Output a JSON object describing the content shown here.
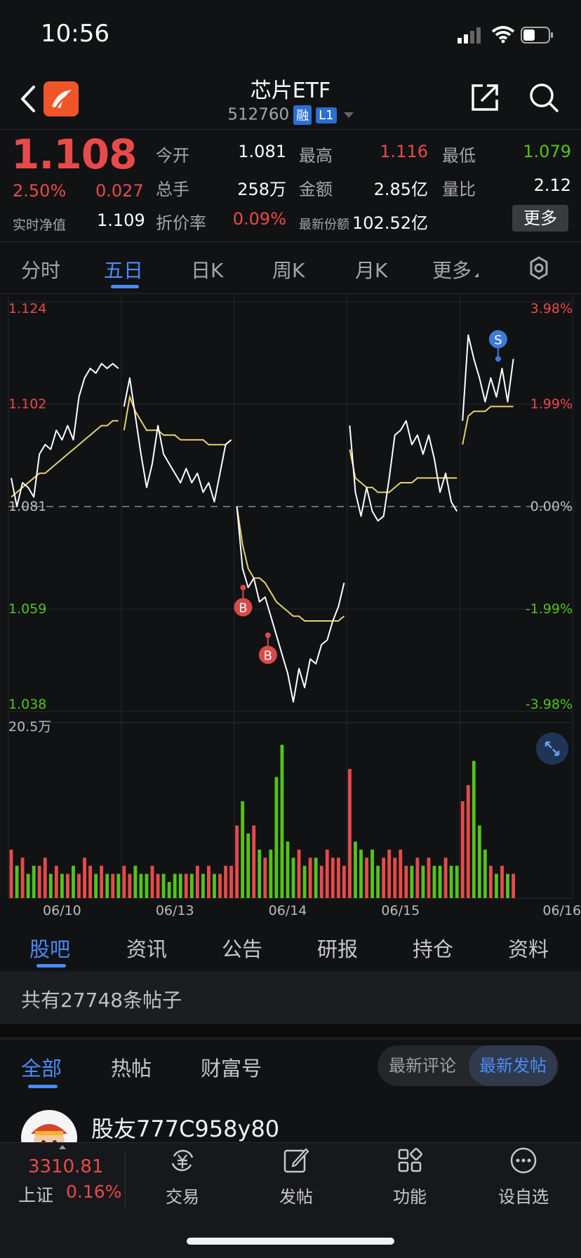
{
  "status": {
    "time": "10:56"
  },
  "header": {
    "title": "芯片ETF",
    "code": "512760",
    "tag_rong": "融",
    "tag_level": "L1"
  },
  "quote": {
    "price": "1.108",
    "pct": "2.50%",
    "change": "0.027",
    "nav_label": "实时净值",
    "nav_value": "1.109",
    "open_label": "今开",
    "open_value": "1.081",
    "high_label": "最高",
    "high_value": "1.116",
    "low_label": "最低",
    "low_value": "1.079",
    "vol_label": "总手",
    "vol_value": "258万",
    "amount_label": "金额",
    "amount_value": "2.85亿",
    "ratio_label": "量比",
    "ratio_value": "2.12",
    "discount_label": "折价率",
    "discount_value": "0.09%",
    "shares_label": "最新份额",
    "shares_value": "102.52亿",
    "more": "更多"
  },
  "chart_tabs": [
    "分时",
    "五日",
    "日K",
    "周K",
    "月K",
    "更多"
  ],
  "colors": {
    "up": "#e84a4a",
    "down": "#52c41a",
    "accent": "#4a8cf7",
    "avg_line": "#e5d36a",
    "price_line": "#ffffff"
  },
  "chart_data": {
    "type": "line",
    "title": "",
    "y_axis_left": [
      "1.124",
      "1.102",
      "1.081",
      "1.059",
      "1.038"
    ],
    "y_axis_right": [
      "3.98%",
      "1.99%",
      "0.00%",
      "-1.99%",
      "-3.98%"
    ],
    "ylim": [
      1.038,
      1.124
    ],
    "prev_close": 1.081,
    "x_labels": [
      "06/10",
      "06/13",
      "06/14",
      "06/15",
      "06/16"
    ],
    "volume_max_label": "20.5万",
    "markers": [
      {
        "label": "B",
        "day": 2,
        "pos": 0.08,
        "price": 1.064
      },
      {
        "label": "B",
        "day": 2,
        "pos": 0.3,
        "price": 1.054
      },
      {
        "label": "S",
        "day": 4,
        "pos": 0.34,
        "price": 1.112
      }
    ],
    "days": [
      {
        "date": "06/10",
        "price": [
          1.087,
          1.081,
          1.086,
          1.085,
          1.083,
          1.092,
          1.094,
          1.093,
          1.097,
          1.095,
          1.098,
          1.095,
          1.104,
          1.108,
          1.11,
          1.109,
          1.111,
          1.11,
          1.111,
          1.11
        ],
        "avg": [
          1.083,
          1.084,
          1.085,
          1.086,
          1.087,
          1.088,
          1.088,
          1.089,
          1.09,
          1.091,
          1.092,
          1.093,
          1.094,
          1.095,
          1.096,
          1.097,
          1.098,
          1.098,
          1.099,
          1.099
        ]
      },
      {
        "date": "06/13",
        "price": [
          1.102,
          1.108,
          1.1,
          1.092,
          1.085,
          1.09,
          1.098,
          1.092,
          1.09,
          1.088,
          1.086,
          1.089,
          1.086,
          1.088,
          1.084,
          1.086,
          1.082,
          1.088,
          1.094,
          1.095
        ],
        "avg": [
          1.097,
          1.104,
          1.101,
          1.099,
          1.097,
          1.097,
          1.097,
          1.096,
          1.096,
          1.096,
          1.095,
          1.095,
          1.095,
          1.095,
          1.095,
          1.094,
          1.094,
          1.094,
          1.094,
          1.095
        ]
      },
      {
        "date": "06/14",
        "price": [
          1.081,
          1.068,
          1.064,
          1.066,
          1.061,
          1.062,
          1.058,
          1.054,
          1.05,
          1.046,
          1.04,
          1.047,
          1.043,
          1.049,
          1.048,
          1.052,
          1.053,
          1.057,
          1.06,
          1.065
        ],
        "avg": [
          1.081,
          1.073,
          1.068,
          1.066,
          1.066,
          1.065,
          1.063,
          1.061,
          1.06,
          1.059,
          1.058,
          1.058,
          1.057,
          1.057,
          1.057,
          1.057,
          1.057,
          1.057,
          1.057,
          1.058
        ]
      },
      {
        "date": "06/15",
        "price": [
          1.098,
          1.084,
          1.079,
          1.085,
          1.08,
          1.078,
          1.079,
          1.087,
          1.096,
          1.097,
          1.099,
          1.094,
          1.096,
          1.092,
          1.096,
          1.091,
          1.084,
          1.088,
          1.082,
          1.08
        ],
        "avg": [
          1.093,
          1.087,
          1.086,
          1.085,
          1.085,
          1.084,
          1.084,
          1.084,
          1.085,
          1.086,
          1.086,
          1.086,
          1.087,
          1.087,
          1.087,
          1.087,
          1.087,
          1.087,
          1.087,
          1.087
        ]
      },
      {
        "date": "06/16",
        "price": [
          1.099,
          1.117,
          1.112,
          1.108,
          1.103,
          1.108,
          1.104,
          1.11,
          1.103,
          1.112
        ],
        "avg": [
          1.094,
          1.1,
          1.101,
          1.101,
          1.101,
          1.102,
          1.102,
          1.102,
          1.102,
          1.102
        ]
      }
    ],
    "volumes": [
      [
        6,
        4,
        5,
        3,
        4,
        4,
        5,
        3,
        4,
        3,
        3,
        4,
        3,
        5,
        4,
        3,
        4,
        3,
        3,
        3
      ],
      [
        4,
        3,
        4,
        3,
        3,
        4,
        3,
        3,
        2,
        3,
        3,
        3,
        3,
        4,
        3,
        4,
        3,
        3,
        4,
        4
      ],
      [
        9,
        12,
        8,
        9,
        6,
        5,
        6,
        15,
        19,
        7,
        5,
        6,
        4,
        5,
        5,
        4,
        6,
        5,
        5,
        4
      ],
      [
        16,
        7,
        6,
        5,
        6,
        4,
        5,
        6,
        5,
        6,
        4,
        4,
        5,
        4,
        5,
        4,
        4,
        5,
        4,
        4
      ],
      [
        12,
        14,
        17,
        9,
        6,
        4,
        3,
        4,
        3,
        3
      ]
    ]
  },
  "content_tabs": [
    "股吧",
    "资讯",
    "公告",
    "研报",
    "持仓",
    "资料"
  ],
  "post_count_text": "共有27748条帖子",
  "sub_tabs": [
    "全部",
    "热帖",
    "财富号"
  ],
  "sort_options": [
    "最新评论",
    "最新发帖"
  ],
  "post": {
    "username": "股友777C958y80"
  },
  "bottom": {
    "index_value": "3310.81",
    "index_name": "上证",
    "index_pct": "0.16%",
    "nav": [
      {
        "label": "交易",
        "icon": "trade-icon"
      },
      {
        "label": "发帖",
        "icon": "compose-icon"
      },
      {
        "label": "功能",
        "icon": "apps-icon"
      },
      {
        "label": "设自选",
        "icon": "more-icon"
      }
    ]
  }
}
